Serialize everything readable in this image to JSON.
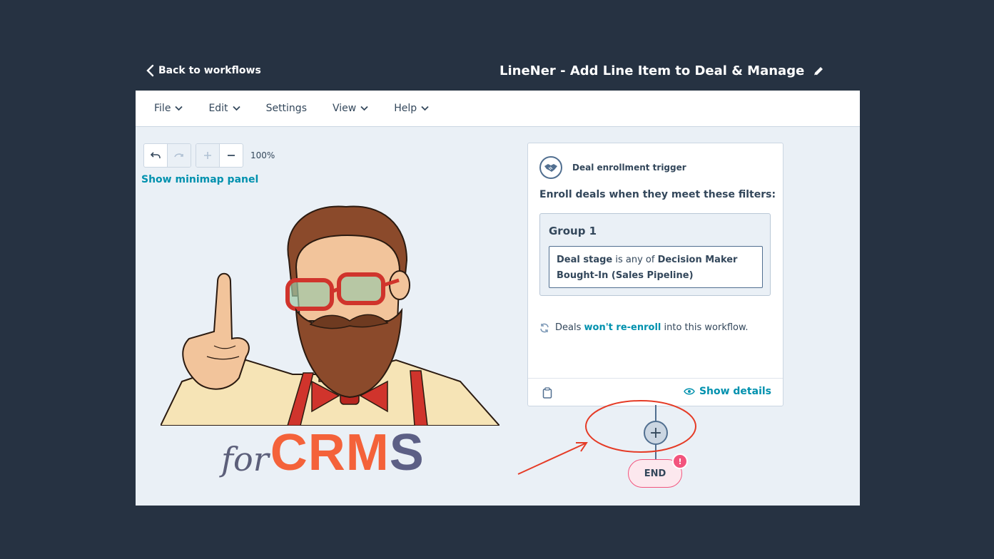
{
  "header": {
    "back_label": "Back to workflows",
    "workflow_title": "LineNer - Add Line Item to Deal & Manage"
  },
  "menu": {
    "items": [
      {
        "label": "File",
        "has_dropdown": true
      },
      {
        "label": "Edit",
        "has_dropdown": true
      },
      {
        "label": "Settings",
        "has_dropdown": false
      },
      {
        "label": "View",
        "has_dropdown": true
      },
      {
        "label": "Help",
        "has_dropdown": true
      }
    ]
  },
  "canvas": {
    "zoom_level": "100%",
    "minimap_link": "Show minimap panel"
  },
  "trigger_card": {
    "label": "Deal enrollment trigger",
    "enroll_text": "Enroll deals when they meet these filters:",
    "group_title": "Group 1",
    "filter": {
      "property": "Deal stage",
      "operator": " is any of ",
      "value": "Decision Maker Bought-In (Sales Pipeline)"
    },
    "reenroll": {
      "prefix": "Deals ",
      "link": "won't re-enroll",
      "suffix": " into this workflow."
    },
    "show_details": "Show details"
  },
  "nodes": {
    "plus": "+",
    "end_label": "END",
    "alert": "!"
  },
  "logo": {
    "for": "for",
    "crm": "CRM",
    "s": "S"
  },
  "colors": {
    "background": "#263242",
    "canvas": "#eaf0f6",
    "link": "#0091ae",
    "text": "#33475b",
    "end_border": "#f2547d",
    "annotation": "#e53b26",
    "logo_orange": "#f4623a",
    "logo_slate": "#5c5f85"
  }
}
